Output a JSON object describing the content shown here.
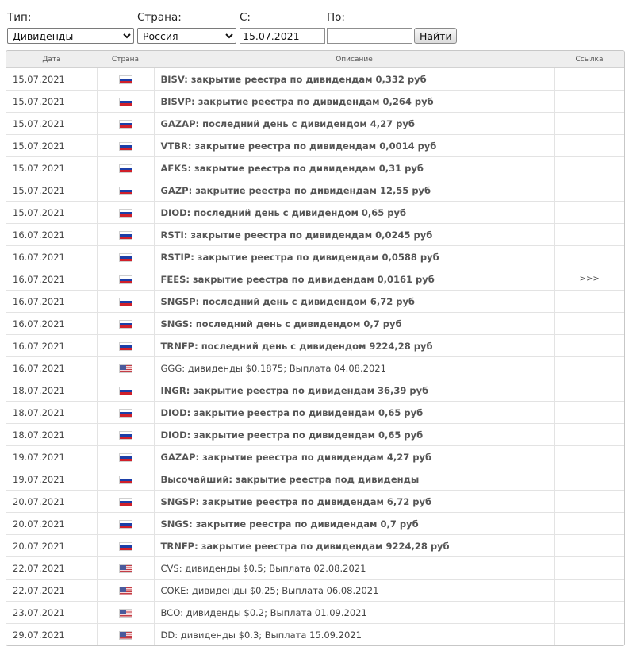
{
  "filters": {
    "type_label": "Тип:",
    "type_value": "Дивиденды",
    "country_label": "Страна:",
    "country_value": "Россия",
    "from_label": "С:",
    "from_value": "15.07.2021",
    "to_label": "По:",
    "to_value": "",
    "submit_label": "Найти"
  },
  "table": {
    "headers": {
      "date": "Дата",
      "country": "Страна",
      "description": "Описание",
      "link": "Ссылка"
    },
    "rows": [
      {
        "date": "15.07.2021",
        "flag": "ru-flag-icon",
        "description": "BISV: закрытие реестра по дивидендам 0,332 руб",
        "link": ""
      },
      {
        "date": "15.07.2021",
        "flag": "ru-flag-icon",
        "description": "BISVP: закрытие реестра по дивидендам 0,264 руб",
        "link": ""
      },
      {
        "date": "15.07.2021",
        "flag": "ru-flag-icon",
        "description": "GAZAP: последний день с дивидендом 4,27 руб",
        "link": ""
      },
      {
        "date": "15.07.2021",
        "flag": "ru-flag-icon",
        "description": "VTBR: закрытие реестра по дивидендам 0,0014 руб",
        "link": ""
      },
      {
        "date": "15.07.2021",
        "flag": "ru-flag-icon",
        "description": "AFKS: закрытие реестра по дивидендам 0,31 руб",
        "link": ""
      },
      {
        "date": "15.07.2021",
        "flag": "ru-flag-icon",
        "description": "GAZP: закрытие реестра по дивидендам 12,55 руб",
        "link": ""
      },
      {
        "date": "15.07.2021",
        "flag": "ru-flag-icon",
        "description": "DIOD: последний день с дивидендом 0,65 руб",
        "link": ""
      },
      {
        "date": "16.07.2021",
        "flag": "ru-flag-icon",
        "description": "RSTI: закрытие реестра по дивидендам 0,0245 руб",
        "link": ""
      },
      {
        "date": "16.07.2021",
        "flag": "ru-flag-icon",
        "description": "RSTIP: закрытие реестра по дивидендам 0,0588 руб",
        "link": ""
      },
      {
        "date": "16.07.2021",
        "flag": "ru-flag-icon",
        "description": "FEES: закрытие реестра по дивидендам 0,0161 руб",
        "link": ">>>"
      },
      {
        "date": "16.07.2021",
        "flag": "ru-flag-icon",
        "description": "SNGSP: последний день с дивидендом 6,72 руб",
        "link": ""
      },
      {
        "date": "16.07.2021",
        "flag": "ru-flag-icon",
        "description": "SNGS: последний день с дивидендом 0,7 руб",
        "link": ""
      },
      {
        "date": "16.07.2021",
        "flag": "ru-flag-icon",
        "description": "TRNFP: последний день с дивидендом 9224,28 руб",
        "link": ""
      },
      {
        "date": "16.07.2021",
        "flag": "us-flag-icon",
        "description": "GGG: дивиденды $0.1875; Выплата 04.08.2021",
        "link": ""
      },
      {
        "date": "18.07.2021",
        "flag": "ru-flag-icon",
        "description": "INGR: закрытие реестра по дивидендам 36,39 руб",
        "link": ""
      },
      {
        "date": "18.07.2021",
        "flag": "ru-flag-icon",
        "description": "DIOD: закрытие реестра по дивидендам 0,65 руб",
        "link": ""
      },
      {
        "date": "18.07.2021",
        "flag": "ru-flag-icon",
        "description": "DIOD: закрытие реестра по дивидендам 0,65 руб",
        "link": ""
      },
      {
        "date": "19.07.2021",
        "flag": "ru-flag-icon",
        "description": "GAZAP: закрытие реестра по дивидендам 4,27 руб",
        "link": ""
      },
      {
        "date": "19.07.2021",
        "flag": "ru-flag-icon",
        "description": "Высочайший: закрытие реестра под дивиденды",
        "link": ""
      },
      {
        "date": "20.07.2021",
        "flag": "ru-flag-icon",
        "description": "SNGSP: закрытие реестра по дивидендам 6,72 руб",
        "link": ""
      },
      {
        "date": "20.07.2021",
        "flag": "ru-flag-icon",
        "description": "SNGS: закрытие реестра по дивидендам 0,7 руб",
        "link": ""
      },
      {
        "date": "20.07.2021",
        "flag": "ru-flag-icon",
        "description": "TRNFP: закрытие реестра по дивидендам 9224,28 руб",
        "link": ""
      },
      {
        "date": "22.07.2021",
        "flag": "us-flag-icon",
        "description": "CVS: дивиденды $0.5; Выплата 02.08.2021",
        "link": ""
      },
      {
        "date": "22.07.2021",
        "flag": "us-flag-icon",
        "description": "COKE: дивиденды $0.25; Выплата 06.08.2021",
        "link": ""
      },
      {
        "date": "23.07.2021",
        "flag": "us-flag-icon",
        "description": "BCO: дивиденды $0.2; Выплата 01.09.2021",
        "link": ""
      },
      {
        "date": "29.07.2021",
        "flag": "us-flag-icon",
        "description": "DD: дивиденды $0.3; Выплата 15.09.2021",
        "link": ""
      }
    ]
  }
}
